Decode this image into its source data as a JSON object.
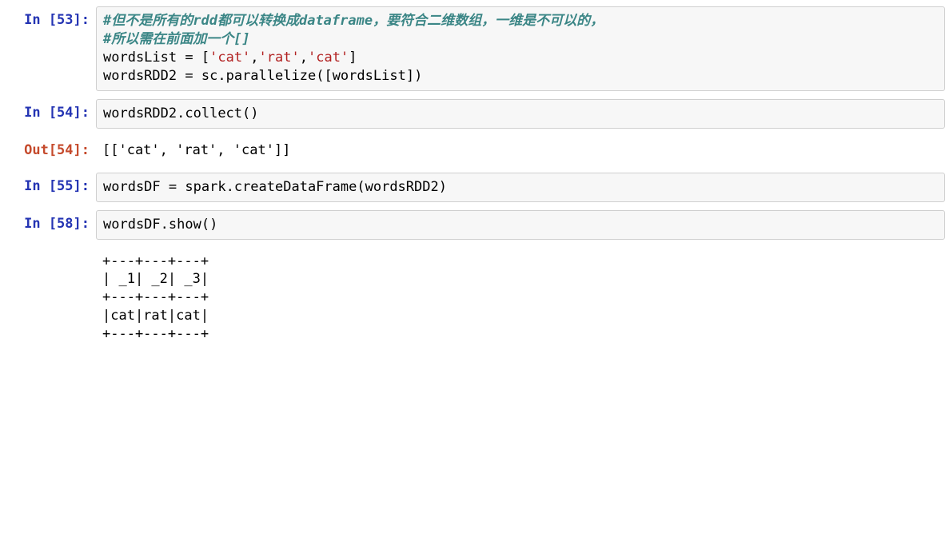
{
  "cells": {
    "c53": {
      "prompt_in": "In [53]:",
      "code": {
        "comment_line1_pre": "#但不是所有的",
        "comment_line1_kw1": "rdd",
        "comment_line1_mid": "都可以转换成",
        "comment_line1_kw2": "dataframe",
        "comment_line1_post": "，要符合二维数组，一维是不可以的，",
        "comment_line2_pre": "#所以需在前面加一个",
        "comment_line2_kw": "[]",
        "line3_left": "wordsList ",
        "line3_eq": "=",
        "line3_sp": " ",
        "line3_br_open": "[",
        "line3_s1": "'cat'",
        "line3_c1": ",",
        "line3_s2": "'rat'",
        "line3_c2": ",",
        "line3_s3": "'cat'",
        "line3_br_close": "]",
        "line4_left": "wordsRDD2 ",
        "line4_eq": "=",
        "line4_sp": " ",
        "line4_call1": "sc",
        "line4_dot": ".",
        "line4_call2": "parallelize",
        "line4_p_open": "(",
        "line4_b_open": "[",
        "line4_arg": "wordsList",
        "line4_b_close": "]",
        "line4_p_close": ")"
      }
    },
    "c54": {
      "prompt_in": "In [54]:",
      "code": {
        "line1_obj": "wordsRDD2",
        "line1_dot": ".",
        "line1_fn": "collect",
        "line1_par": "()"
      },
      "prompt_out": "Out[54]:",
      "output": "[['cat', 'rat', 'cat']]"
    },
    "c55": {
      "prompt_in": "In [55]:",
      "code": {
        "line1_left": "wordsDF ",
        "line1_eq": "=",
        "line1_sp": " ",
        "line1_obj": "spark",
        "line1_dot": ".",
        "line1_fn": "createDataFrame",
        "line1_p_open": "(",
        "line1_arg": "wordsRDD2",
        "line1_p_close": ")"
      }
    },
    "c58": {
      "prompt_in": "In [58]:",
      "code": {
        "line1_obj": "wordsDF",
        "line1_dot": ".",
        "line1_fn": "show",
        "line1_par": "()"
      },
      "output": "+---+---+---+\n| _1| _2| _3|\n+---+---+---+\n|cat|rat|cat|\n+---+---+---+"
    }
  }
}
